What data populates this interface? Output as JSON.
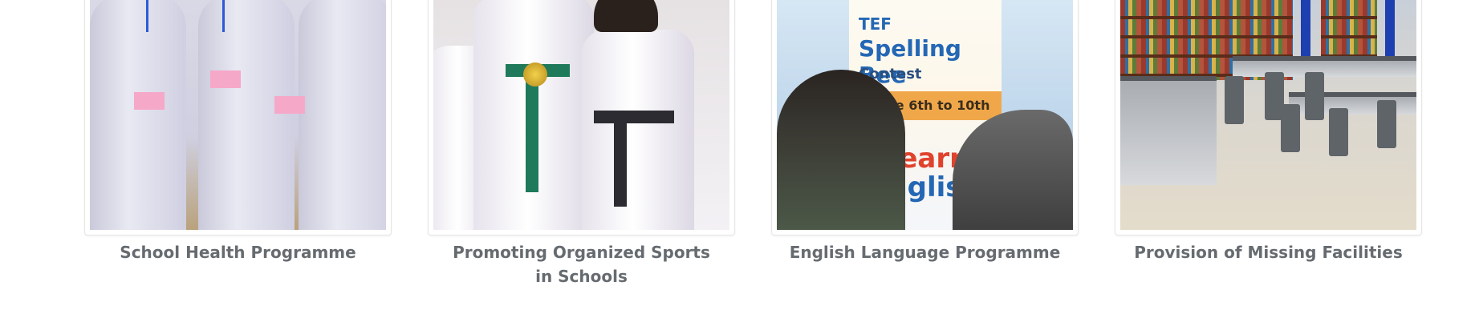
{
  "programmes": [
    {
      "title": "School Health Programme"
    },
    {
      "title": "Promoting Organized Sports in Schools"
    },
    {
      "title": "English Language Programme"
    },
    {
      "title": "Provision of Missing Facilities"
    }
  ],
  "poster": {
    "brand": "TEF",
    "heading": "Spelling Bee",
    "subheading": "Contest",
    "grade": "Grade 6th to 10th",
    "line1": "Learn",
    "line2": "English"
  },
  "colors": {
    "caption_text": "#666b70",
    "card_border": "#e6e6e6"
  }
}
